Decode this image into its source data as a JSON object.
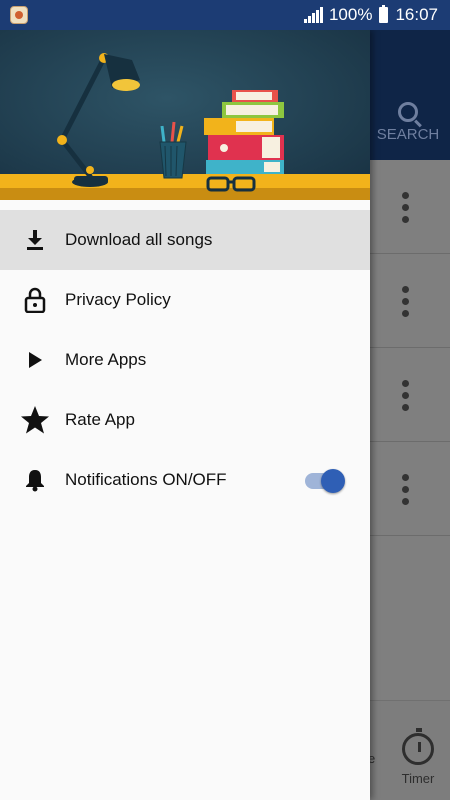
{
  "status_bar": {
    "battery": "100%",
    "time": "16:07"
  },
  "background": {
    "search_label": "SEARCH",
    "timer_label": "Timer",
    "partial_tab_label": "e"
  },
  "drawer": {
    "menu": [
      {
        "label": "Download all songs",
        "icon": "download-icon",
        "active": true
      },
      {
        "label": "Privacy Policy",
        "icon": "lock-icon",
        "active": false
      },
      {
        "label": "More Apps",
        "icon": "play-icon",
        "active": false
      },
      {
        "label": "Rate App",
        "icon": "star-icon",
        "active": false
      },
      {
        "label": "Notifications ON/OFF",
        "icon": "bell-icon",
        "active": false,
        "toggle": true
      }
    ]
  },
  "colors": {
    "status_bar": "#1c3c74",
    "toggle_on": "#2f5fb5",
    "header_bg": "#1f3e4f",
    "desk": "#f2b31b"
  }
}
